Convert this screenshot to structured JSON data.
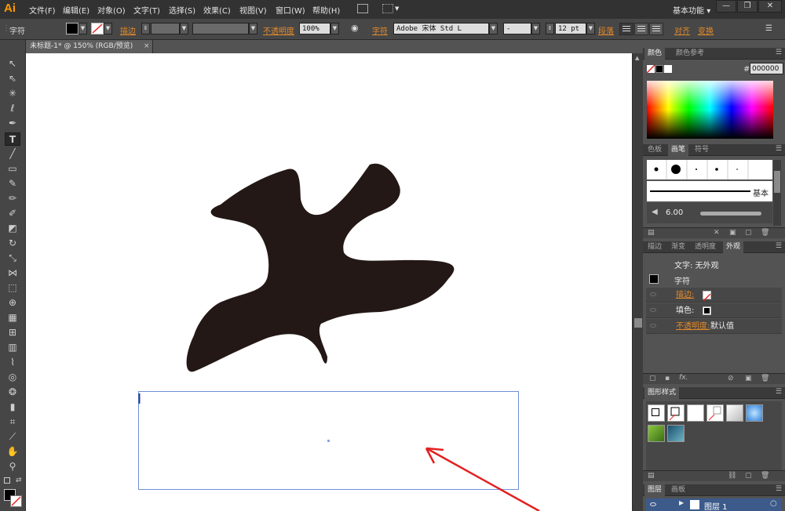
{
  "app": {
    "logo": "Ai",
    "workspace": "基本功能",
    "workspace_chevron": "▾"
  },
  "menu": [
    "文件(F)",
    "编辑(E)",
    "对象(O)",
    "文字(T)",
    "选择(S)",
    "效果(C)",
    "视图(V)",
    "窗口(W)",
    "帮助(H)"
  ],
  "window_buttons": {
    "minimize": "—",
    "restore": "❐",
    "close": "✕"
  },
  "controlbar": {
    "mode_label": "字符",
    "stroke_label": "描边",
    "opacity_label": "不透明度",
    "opacity_value": "100%",
    "char_label": "字符",
    "font_family": "Adobe 宋体 Std L",
    "font_style": "-",
    "font_size": "12 pt",
    "paragraph_label": "段落",
    "align_label": "对齐",
    "transform_label": "变换"
  },
  "document": {
    "tab_title": "未标题-1* @ 150% (RGB/预览)",
    "close": "×"
  },
  "color_panel": {
    "tabs": [
      "颜色",
      "颜色参考"
    ],
    "hash": "#",
    "hex_value": "000000"
  },
  "brush_panel": {
    "tabs": [
      "色板",
      "画笔",
      "符号"
    ],
    "basic_label": "基本",
    "size_value": "6.00"
  },
  "appearance_panel": {
    "tabs": [
      "描边",
      "渐变",
      "透明度",
      "外观"
    ],
    "header": "文字: 无外观",
    "item_label": "字符",
    "stroke_label": "描边:",
    "fill_label": "填色:",
    "opacity_label": "不透明度:",
    "opacity_value": "默认值",
    "fx_label": "fx."
  },
  "graphic_styles_panel": {
    "tabs": [
      "图形样式"
    ]
  },
  "layers_panel": {
    "tabs": [
      "图层",
      "画板"
    ],
    "layer_name": "图层 1"
  },
  "colors": {
    "accent": "#e48a2a",
    "shape_fill": "#231815",
    "arrow": "#e32020",
    "textbox_border": "#6f8fd8"
  }
}
